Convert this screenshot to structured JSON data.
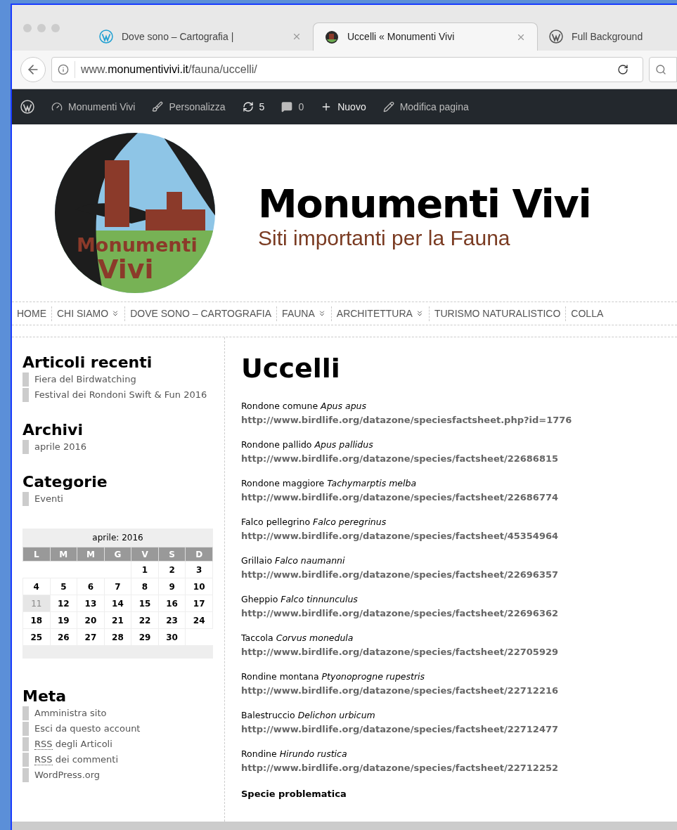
{
  "browser": {
    "tabs": [
      {
        "title": "Dove sono – Cartografia |",
        "selected": false,
        "closable": true
      },
      {
        "title": "Uccelli « Monumenti Vivi",
        "selected": true,
        "closable": true
      },
      {
        "title": "Full Background",
        "selected": false,
        "closable": false
      }
    ],
    "url": {
      "prefix": "www.",
      "domain": "monumentivivi.it",
      "path": "/fauna/uccelli/"
    }
  },
  "admin_bar": [
    {
      "kind": "logo"
    },
    {
      "kind": "site",
      "label": "Monumenti Vivi"
    },
    {
      "kind": "customize",
      "label": "Personalizza"
    },
    {
      "kind": "updates",
      "label": "5"
    },
    {
      "kind": "comments",
      "label": "0"
    },
    {
      "kind": "new",
      "label": "Nuovo"
    },
    {
      "kind": "edit",
      "label": "Modifica pagina"
    }
  ],
  "header": {
    "logo_text": [
      "Monumenti",
      "Vivi"
    ],
    "title": "Monumenti Vivi",
    "tagline": "Siti importanti per la Fauna"
  },
  "nav": [
    {
      "label": "HOME",
      "submenu": false
    },
    {
      "label": "CHI SIAMO",
      "submenu": true
    },
    {
      "label": "DOVE SONO – CARTOGRAFIA",
      "submenu": false
    },
    {
      "label": "FAUNA",
      "submenu": true
    },
    {
      "label": "ARCHITETTURA",
      "submenu": true
    },
    {
      "label": "TURISMO NATURALISTICO",
      "submenu": false
    },
    {
      "label": "COLLA",
      "submenu": false
    }
  ],
  "sidebar": {
    "widgets": [
      {
        "title": "Articoli recenti",
        "items": [
          {
            "text": "Fiera del Birdwatching"
          },
          {
            "text": "Festival dei Rondoni Swift & Fun 2016"
          }
        ]
      },
      {
        "title": "Archivi",
        "items": [
          {
            "text": "aprile 2016"
          }
        ]
      },
      {
        "title": "Categorie",
        "items": [
          {
            "text": "Eventi"
          }
        ]
      }
    ],
    "calendar": {
      "caption": "aprile: 2016",
      "weekdays": [
        "L",
        "M",
        "M",
        "G",
        "V",
        "S",
        "D"
      ],
      "weeks": [
        [
          {
            "kind": "blank"
          },
          {
            "kind": "blank"
          },
          {
            "kind": "blank"
          },
          {
            "kind": "blank"
          },
          {
            "kind": "day",
            "text": "1",
            "today": false
          },
          {
            "kind": "day",
            "text": "2",
            "today": false
          },
          {
            "kind": "day",
            "text": "3",
            "today": false
          }
        ],
        [
          {
            "kind": "day",
            "text": "4",
            "today": false
          },
          {
            "kind": "day",
            "text": "5",
            "today": false
          },
          {
            "kind": "day",
            "text": "6",
            "today": false
          },
          {
            "kind": "day",
            "text": "7",
            "today": false
          },
          {
            "kind": "day",
            "text": "8",
            "today": false
          },
          {
            "kind": "day",
            "text": "9",
            "today": false
          },
          {
            "kind": "day",
            "text": "10",
            "today": false
          }
        ],
        [
          {
            "kind": "day",
            "text": "11",
            "today": true
          },
          {
            "kind": "day",
            "text": "12",
            "today": false
          },
          {
            "kind": "day",
            "text": "13",
            "today": false
          },
          {
            "kind": "day",
            "text": "14",
            "today": false
          },
          {
            "kind": "day",
            "text": "15",
            "today": false
          },
          {
            "kind": "day",
            "text": "16",
            "today": false
          },
          {
            "kind": "day",
            "text": "17",
            "today": false
          }
        ],
        [
          {
            "kind": "day",
            "text": "18",
            "today": false
          },
          {
            "kind": "day",
            "text": "19",
            "today": false
          },
          {
            "kind": "day",
            "text": "20",
            "today": false
          },
          {
            "kind": "day",
            "text": "21",
            "today": false
          },
          {
            "kind": "day",
            "text": "22",
            "today": false
          },
          {
            "kind": "day",
            "text": "23",
            "today": false
          },
          {
            "kind": "day",
            "text": "24",
            "today": false
          }
        ],
        [
          {
            "kind": "day",
            "text": "25",
            "today": false
          },
          {
            "kind": "day",
            "text": "26",
            "today": false
          },
          {
            "kind": "day",
            "text": "27",
            "today": false
          },
          {
            "kind": "day",
            "text": "28",
            "today": false
          },
          {
            "kind": "day",
            "text": "29",
            "today": false
          },
          {
            "kind": "day",
            "text": "30",
            "today": false
          },
          {
            "kind": "blank"
          }
        ]
      ]
    },
    "meta": {
      "title": "Meta",
      "items": [
        {
          "text": "Amministra sito"
        },
        {
          "text": "Esci da questo account"
        },
        {
          "abbr": "RSS",
          "text": "degli Articoli"
        },
        {
          "abbr": "RSS",
          "text": "dei commenti"
        },
        {
          "text": "WordPress.org"
        }
      ]
    }
  },
  "content": {
    "title": "Uccelli",
    "species": [
      {
        "name": "Rondone comune *Apus apus*",
        "url": "http://www.birdlife.org/datazone/speciesfactsheet.php?id=1776"
      },
      {
        "name": "Rondone pallido *Apus pallidus*",
        "url": "http://www.birdlife.org/datazone/species/factsheet/22686815"
      },
      {
        "name": "Rondone maggiore *Tachymarptis melba*",
        "url": "http://www.birdlife.org/datazone/species/factsheet/22686774"
      },
      {
        "name": "Falco pellegrino *Falco peregrinus*",
        "url": "http://www.birdlife.org/datazone/species/factsheet/45354964"
      },
      {
        "name": "Grillaio *Falco naumanni*",
        "url": "http://www.birdlife.org/datazone/species/factsheet/22696357"
      },
      {
        "name": "Gheppio *Falco tinnunculus*",
        "url": "http://www.birdlife.org/datazone/species/factsheet/22696362"
      },
      {
        "name": "Taccola *Corvus monedula*",
        "url": "http://www.birdlife.org/datazone/species/factsheet/22705929"
      },
      {
        "name": "Rondine montana *Ptyonoprogne rupestris*",
        "url": "http://www.birdlife.org/datazone/species/factsheet/22712216"
      },
      {
        "name": "Balestruccio *Delichon urbicum*",
        "url": "http://www.birdlife.org/datazone/species/factsheet/22712477"
      },
      {
        "name": "Rondine *Hirundo rustica*",
        "url": "http://www.birdlife.org/datazone/species/factsheet/22712252"
      }
    ],
    "subheading": "Specie problematica"
  }
}
